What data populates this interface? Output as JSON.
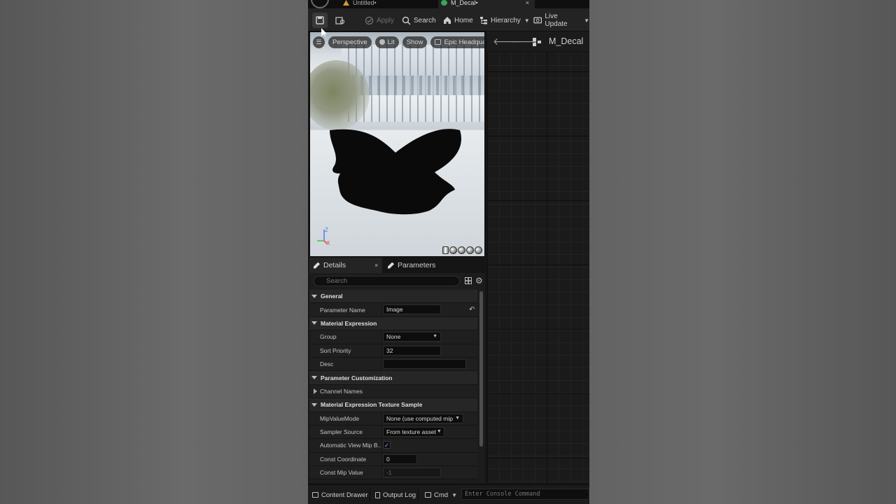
{
  "tabs": [
    {
      "label": "Untitled•",
      "icon": "level-icon"
    },
    {
      "label": "M_Decal•",
      "icon": "material-icon",
      "close": "×"
    }
  ],
  "toolbar": {
    "apply": "Apply",
    "search": "Search",
    "home": "Home",
    "hierarchy": "Hierarchy",
    "live_update": "Live Update"
  },
  "viewport": {
    "perspective": "Perspective",
    "lit": "Lit",
    "show": "Show",
    "environment": "Epic Headquarters",
    "axis_z": "Z",
    "axis_x": "X"
  },
  "graph": {
    "title": "M_Decal"
  },
  "details": {
    "tab_details": "Details",
    "tab_close": "×",
    "tab_parameters": "Parameters",
    "search_placeholder": "Search",
    "categories": {
      "general": "General",
      "material_expression": "Material Expression",
      "parameter_customization": "Parameter Customization",
      "texture_sample": "Material Expression Texture Sample"
    },
    "props": {
      "parameter_name": {
        "label": "Parameter Name",
        "value": "Image"
      },
      "group": {
        "label": "Group",
        "value": "None"
      },
      "sort_priority": {
        "label": "Sort Priority",
        "value": "32"
      },
      "desc": {
        "label": "Desc",
        "value": ""
      },
      "channel_names": {
        "label": "Channel Names"
      },
      "mip_value_mode": {
        "label": "MipValueMode",
        "value": "None (use computed mip lev"
      },
      "sampler_source": {
        "label": "Sampler Source",
        "value": "From texture asset"
      },
      "auto_view_mip": {
        "label": "Automatic View Mip B...",
        "checked": true
      },
      "const_coordinate": {
        "label": "Const Coordinate",
        "value": "0"
      },
      "const_mip_value": {
        "label": "Const Mip Value",
        "value": "-1"
      }
    }
  },
  "statusbar": {
    "content_drawer": "Content Drawer",
    "output_log": "Output Log",
    "cmd": "Cmd",
    "console_placeholder": "Enter Console Command"
  },
  "colors": {
    "panel_bg": "#1c1c1c",
    "accent_checkbox": "#6aaaf0",
    "material_tab_icon": "#3aa55a"
  }
}
